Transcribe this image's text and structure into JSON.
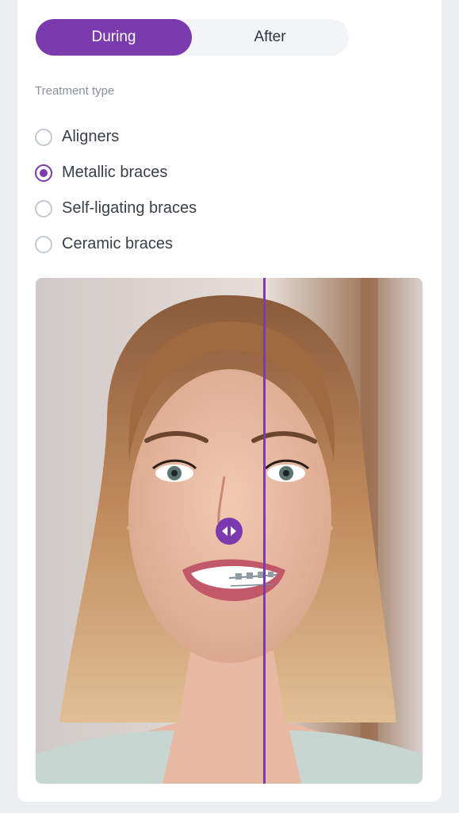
{
  "toggle": {
    "options": [
      "During",
      "After"
    ],
    "selected": "During"
  },
  "treatment": {
    "label": "Treatment type",
    "options": [
      "Aligners",
      "Metallic braces",
      "Self-ligating braces",
      "Ceramic braces"
    ],
    "selected": "Metallic braces"
  },
  "comparison": {
    "slider_position_fraction": 0.5,
    "left_image": "smiling-woman-teeth-without-braces",
    "right_image": "smiling-woman-teeth-with-metallic-braces",
    "handle_icon": "left-right-arrows-icon"
  },
  "colors": {
    "accent": "#7b3aad",
    "background": "#eceef2"
  }
}
